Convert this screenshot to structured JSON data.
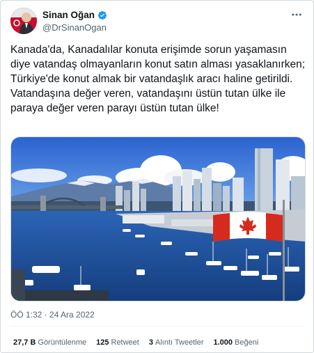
{
  "author": {
    "name": "Sinan Oğan",
    "handle": "@DrSinanOgan",
    "verified": true
  },
  "more_icon": "more-dots-icon",
  "tweet": {
    "text": "Kanada'da, Kanadalılar konuta erişimde sorun yaşamasın diye vatandaş olmayanların konut satın alması yasaklanırken; Türkiye'de konut almak bir vatandaşlık aracı haline getirildi.\nVatandaşına değer veren, vatandaşını üstün tutan ülke ile paraya değer veren parayı üstün tutan ülke!",
    "timestamp": "ÖÖ 1:32 · 24 Ara 2022"
  },
  "stats": {
    "views_count": "27,7 B",
    "views_label": "Görüntülenme",
    "retweets_count": "125",
    "retweets_label": "Retweet",
    "quotes_count": "3",
    "quotes_label": "Alıntı Tweetler",
    "likes_count": "1.000",
    "likes_label": "Beğeni"
  },
  "colors": {
    "verified_blue": "#1d9bf0",
    "flag_red": "#d52b1e",
    "sky": "#2f6fd6",
    "water": "#1d4f9a"
  }
}
